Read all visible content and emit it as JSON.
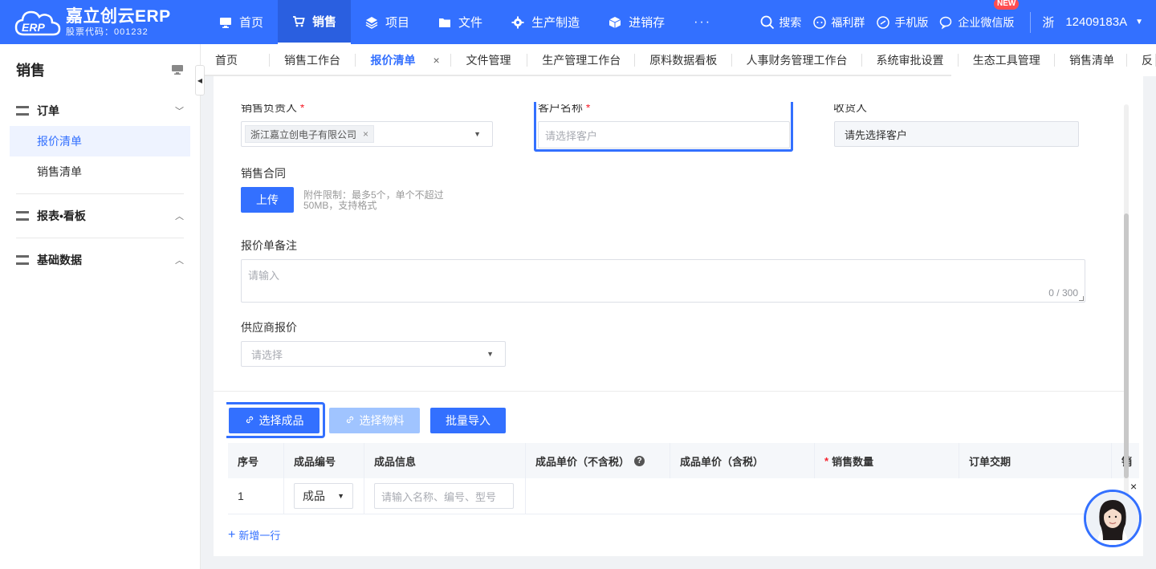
{
  "brand": {
    "name": "嘉立创云ERP",
    "stock_code": "股票代码：001232"
  },
  "nav": [
    {
      "label": "首页",
      "icon": "monitor-icon"
    },
    {
      "label": "销售",
      "icon": "cart-icon"
    },
    {
      "label": "项目",
      "icon": "layers-icon"
    },
    {
      "label": "文件",
      "icon": "folder-icon"
    },
    {
      "label": "生产制造",
      "icon": "gear-icon"
    },
    {
      "label": "进销存",
      "icon": "box-icon"
    }
  ],
  "nav_more": "···",
  "tools": {
    "search": "搜索",
    "welfare": "福利群",
    "mobile": "手机版",
    "wechat": "企业微信版",
    "new_badge": "NEW"
  },
  "user": {
    "province": "浙",
    "account": "12409183A"
  },
  "sidebar": {
    "title": "销售",
    "groups": [
      {
        "label": "订单",
        "items": [
          "报价清单",
          "销售清单"
        ]
      },
      {
        "label": "报表•看板"
      },
      {
        "label": "基础数据"
      }
    ]
  },
  "tabs": [
    "首页",
    "销售工作台",
    "报价清单",
    "文件管理",
    "生产管理工作台",
    "原料数据看板",
    "人事财务管理工作台",
    "系统审批设置",
    "生态工具管理",
    "销售清单",
    "反"
  ],
  "tab_close": "×",
  "form": {
    "sales_owner_label": "销售负责人",
    "sales_owner_tag": "浙江嘉立创电子有限公司",
    "tag_close": "×",
    "customer_label": "客户名称",
    "customer_placeholder": "请选择客户",
    "receiver_label": "收货人",
    "receiver_value": "请先选择客户",
    "required_mark": "*",
    "contract_label": "销售合同",
    "upload_label": "上传",
    "upload_hint_1": "附件限制：最多5个，单个不超过",
    "upload_hint_2": "50MB，支持格式",
    "remark_label": "报价单备注",
    "remark_placeholder": "请输入",
    "remark_counter": "0 / 300",
    "supplier_label": "供应商报价",
    "supplier_placeholder": "请选择"
  },
  "actions": {
    "select_product": "选择成品",
    "select_material": "选择物料",
    "batch_import": "批量导入"
  },
  "table": {
    "headers": [
      "序号",
      "成品编号",
      "成品信息",
      "成品单价（不含税）",
      "成品单价（含税）",
      "销售数量",
      "订单交期",
      "销"
    ],
    "help": "?",
    "rows": [
      {
        "index": "1",
        "type": "成品",
        "info_placeholder": "请输入名称、编号、型号"
      }
    ],
    "add_row": "新增一行"
  },
  "colors": {
    "primary": "#3370ff",
    "disabled": "#a0c4ff",
    "required": "#f5222d"
  },
  "assistant_close": "×"
}
